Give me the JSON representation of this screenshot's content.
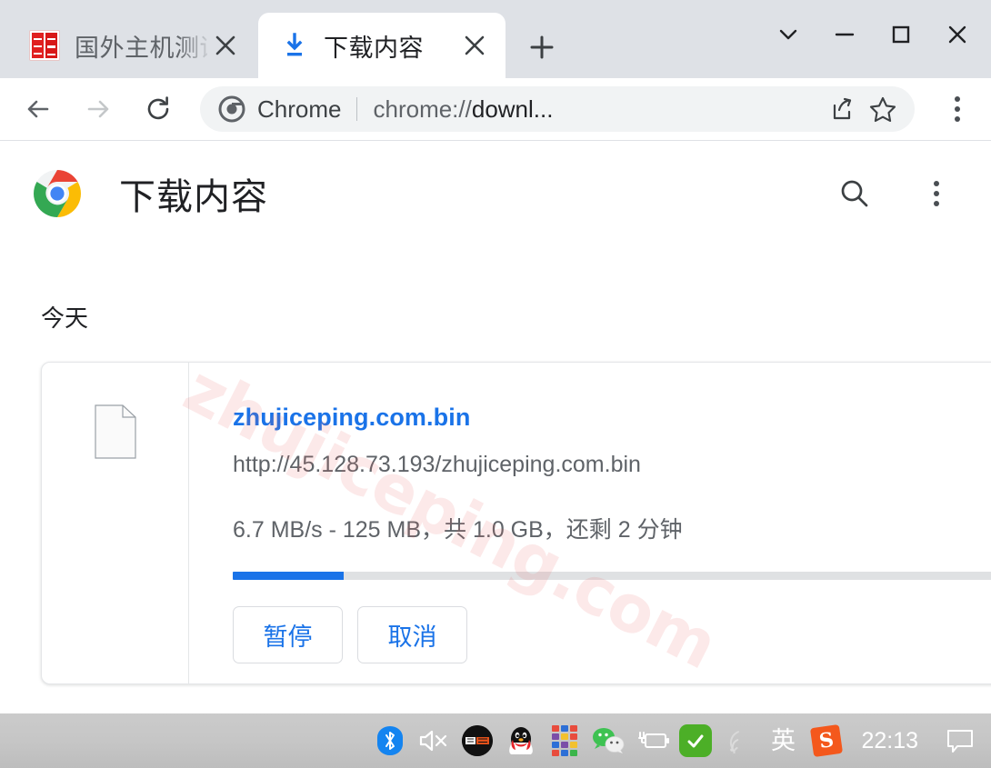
{
  "browser": {
    "tabs": [
      {
        "title": "国外主机测评",
        "favicon": "stamp-favicon",
        "active": false
      },
      {
        "title": "下载内容",
        "favicon": "download-icon",
        "active": true
      }
    ],
    "new_tab_label": "+",
    "window_controls": {
      "tab_search": "tab-search-icon",
      "minimize": "minimize-icon",
      "maximize": "maximize-icon",
      "close": "close-icon"
    },
    "nav": {
      "back": "back-arrow-icon",
      "forward": "forward-arrow-icon",
      "reload": "reload-icon"
    },
    "omnibox": {
      "chrome_label": "Chrome",
      "url_prefix": "chrome://",
      "url_body": "downl...",
      "share_icon": "share-icon",
      "bookmark_icon": "star-icon"
    },
    "menu_icon": "three-dot-menu-icon"
  },
  "downloads_page": {
    "title": "下载内容",
    "logo": "chrome-logo",
    "search_icon": "search-icon",
    "menu_icon": "three-dot-menu-icon",
    "section_label": "今天",
    "item": {
      "file_icon": "generic-file-icon",
      "filename": "zhujiceping.com.bin",
      "url": "http://45.128.73.193/zhujiceping.com.bin",
      "status": "6.7 MB/s - 125 MB，共 1.0 GB，还剩 2 分钟",
      "progress_percent": 12,
      "buttons": [
        {
          "label": "暂停",
          "name": "pause-button"
        },
        {
          "label": "取消",
          "name": "cancel-button"
        }
      ]
    },
    "watermark": "zhujiceping.com"
  },
  "taskbar": {
    "items": [
      {
        "name": "bluetooth-icon"
      },
      {
        "name": "volume-muted-icon"
      },
      {
        "name": "zhujiceping-logo-icon"
      },
      {
        "name": "qq-icon"
      },
      {
        "name": "color-grid-icon"
      },
      {
        "name": "wechat-icon"
      },
      {
        "name": "battery-charging-icon"
      },
      {
        "name": "security-check-icon"
      },
      {
        "name": "wifi-icon"
      },
      {
        "name": "ime-icon"
      },
      {
        "name": "sogou-icon"
      }
    ],
    "ime_label": "英",
    "sogou_label": "S",
    "clock": "22:13",
    "notification_icon": "notification-icon"
  },
  "colors": {
    "accent_blue": "#1a73e8",
    "tab_strip": "#dee1e6",
    "omnibox_bg": "#f1f3f4",
    "taskbar": "#c6c6c6",
    "watermark": "#f5dede"
  }
}
